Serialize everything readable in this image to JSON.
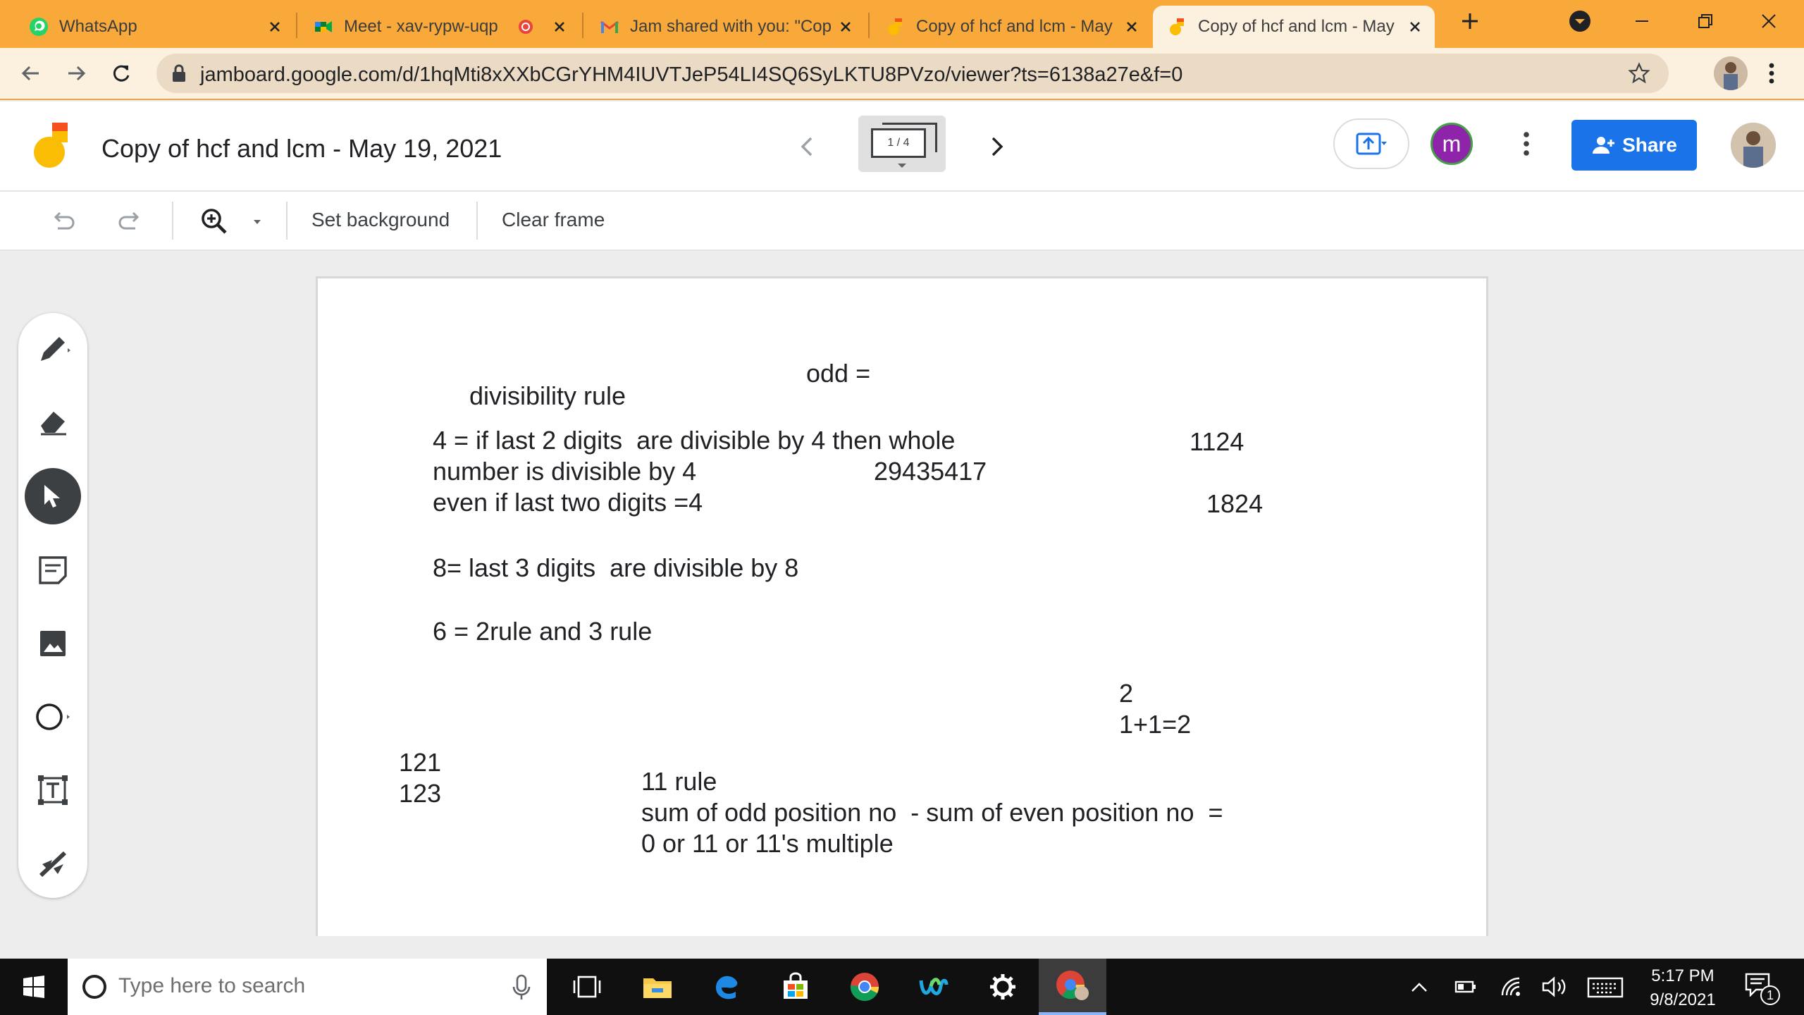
{
  "browser": {
    "tabs": [
      {
        "title": "WhatsApp",
        "icon": "whatsapp-icon",
        "active": false
      },
      {
        "title": "Meet - xav-rypw-uqp",
        "icon": "google-meet-icon",
        "active": false
      },
      {
        "title": "Jam shared with you: \"Cop",
        "icon": "gmail-icon",
        "active": false
      },
      {
        "title": "Copy of hcf and lcm - May",
        "icon": "jamboard-icon",
        "active": false
      },
      {
        "title": "Copy of hcf and lcm - May",
        "icon": "jamboard-icon",
        "active": true
      }
    ],
    "url": "jamboard.google.com/d/1hqMti8xXXbCGrYHM4IUVTJeP54LI4SQ6SyLKTU8PVzo/viewer?ts=6138a27e&f=0",
    "colors": {
      "tabstrip": "#f8a93a",
      "toolbar": "#fcf0df"
    }
  },
  "jamboard": {
    "title": "Copy of hcf and lcm - May 19, 2021",
    "frame_counter": "1 / 4",
    "user_initial": "m",
    "share_label": "Share",
    "accent": "#1a73e8"
  },
  "toolbar": {
    "set_background": "Set background",
    "clear_frame": "Clear frame"
  },
  "canvas_text": {
    "odd": "odd =",
    "divisibility_rule": "divisibility rule",
    "rule4": "4 = if last 2 digits  are divisible by 4 then whole\nnumber is divisible by 4\neven if last two digits =4",
    "num_1124": "1124",
    "num_29435417": "29435417",
    "num_1824": "1824",
    "rule8": "8= last 3 digits  are divisible by 8",
    "rule6": "6 = 2rule and 3 rule",
    "two_calc": "2\n1+1=2",
    "nums_121_123": "121\n123",
    "rule11": "11 rule\nsum of odd position no  - sum of even position no  =\n0 or 11 or 11's multiple"
  },
  "taskbar": {
    "search_placeholder": "Type here to search",
    "time": "5:17 PM",
    "date": "9/8/2021",
    "notifications": "1"
  }
}
